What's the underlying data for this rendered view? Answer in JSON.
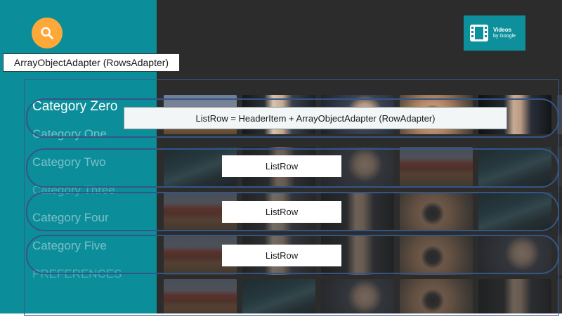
{
  "app": {
    "logo": {
      "icon": "film-strip-icon",
      "title": "Videos",
      "subtitle": "by Google"
    },
    "search": {
      "icon": "search-icon",
      "color": "#ffa83a"
    },
    "colors": {
      "sidebar": "#0c8d9a",
      "main": "#2c2c2c",
      "logo_bg": "#0e909c"
    }
  },
  "sidebar": {
    "headers": [
      {
        "label": "Category Zero",
        "selected": true
      },
      {
        "label": "Category One"
      },
      {
        "label": "Category Two"
      },
      {
        "label": "Category Three"
      },
      {
        "label": "Category Four"
      },
      {
        "label": "Category Five"
      },
      {
        "label": "PREFERENCES"
      }
    ]
  },
  "grid": {
    "rows": [
      [
        "crowd",
        "person",
        "speaker",
        "hand",
        "interview",
        "lecture"
      ],
      [
        "desk",
        "interview",
        "speaker",
        "crowd",
        "desk",
        "lecture"
      ],
      [
        "crowd",
        "person",
        "interview",
        "hand",
        "desk",
        "speaker"
      ],
      [
        "crowd",
        "person",
        "interview",
        "hand",
        "speaker",
        "lecture"
      ],
      [
        "crowd",
        "desk",
        "speaker",
        "hand",
        "interview",
        "lecture"
      ]
    ]
  },
  "annotations": {
    "adapter_label": "ArrayObjectAdapter (RowsAdapter)",
    "row_definition": "ListRow = HeaderItem + ArrayObjectAdapter (RowAdapter)",
    "listrow_labels": [
      "ListRow",
      "ListRow",
      "ListRow"
    ]
  }
}
